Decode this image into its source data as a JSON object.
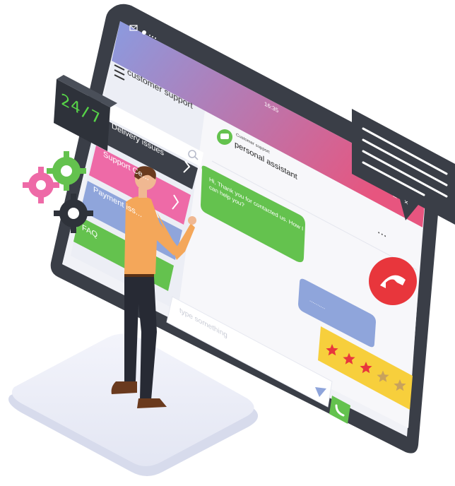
{
  "window": {
    "title": "customer support",
    "time": "16:35"
  },
  "badge": {
    "text": "24/7"
  },
  "menu": {
    "items": [
      {
        "label": "Delivery issues",
        "color": "#3c4049"
      },
      {
        "label": "Support Ce...",
        "color": "#ee6aa7"
      },
      {
        "label": "Payment iss...",
        "color": "#8fa5db"
      },
      {
        "label": "FAQ",
        "color": "#64c24e"
      }
    ]
  },
  "chat": {
    "subtitle": "Customer support",
    "name": "personal assistant",
    "incoming": "Hi, Thank you for contacted us. How I can help you?",
    "outgoing": "..........",
    "more": "...",
    "input_placeholder": "type something"
  },
  "rating": {
    "stars": 5,
    "filled": 3
  },
  "colors": {
    "accent_green": "#64c24e",
    "accent_pink": "#ee6aa7",
    "accent_blue": "#8fa5db",
    "dark": "#3c4049",
    "call_red": "#e8363c",
    "rating_yellow": "#f7cf3c",
    "gradient_start": "#8a9be0",
    "gradient_end": "#e7557f"
  },
  "icons": [
    "menu-icon",
    "search-icon",
    "chevron-right-icon",
    "chat-avatar-icon",
    "send-icon",
    "phone-icon",
    "hang-up-icon",
    "gear-icon",
    "star-icon",
    "speech-bubble-icon",
    "mail-icon"
  ]
}
